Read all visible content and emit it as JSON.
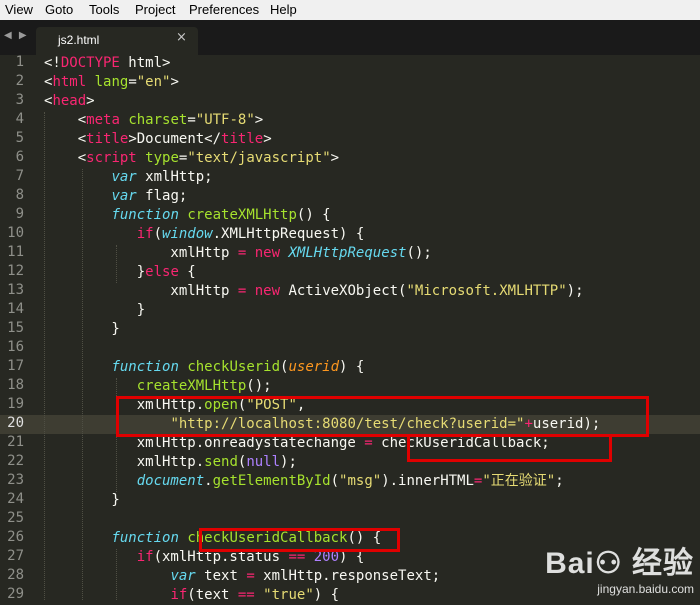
{
  "menu": [
    "View",
    "Goto",
    "Tools",
    "Project",
    "Preferences",
    "Help"
  ],
  "tab": {
    "nav_icons": "◀ ▶",
    "title": "js2.html",
    "close": "×"
  },
  "editor": {
    "active_line": 20,
    "lines": [
      {
        "n": "1",
        "tokens": [
          [
            "w",
            "<!"
          ],
          [
            "k",
            "DOCTYPE"
          ],
          [
            "w",
            " html>"
          ]
        ]
      },
      {
        "n": "2",
        "tokens": [
          [
            "w",
            "<"
          ],
          [
            "k",
            "html"
          ],
          [
            "w",
            " "
          ],
          [
            "a",
            "lang"
          ],
          [
            "w",
            "="
          ],
          [
            "s",
            "\"en\""
          ],
          [
            "w",
            ">"
          ]
        ]
      },
      {
        "n": "3",
        "tokens": [
          [
            "w",
            "<"
          ],
          [
            "k",
            "head"
          ],
          [
            "w",
            ">"
          ]
        ]
      },
      {
        "n": "4",
        "tokens": [
          [
            "w",
            "    <"
          ],
          [
            "k",
            "meta"
          ],
          [
            "w",
            " "
          ],
          [
            "a",
            "charset"
          ],
          [
            "w",
            "="
          ],
          [
            "s",
            "\"UTF-8\""
          ],
          [
            "w",
            ">"
          ]
        ]
      },
      {
        "n": "5",
        "tokens": [
          [
            "w",
            "    <"
          ],
          [
            "k",
            "title"
          ],
          [
            "w",
            ">Document</"
          ],
          [
            "k",
            "title"
          ],
          [
            "w",
            ">"
          ]
        ]
      },
      {
        "n": "6",
        "tokens": [
          [
            "w",
            "    <"
          ],
          [
            "k",
            "script"
          ],
          [
            "w",
            " "
          ],
          [
            "a",
            "type"
          ],
          [
            "w",
            "="
          ],
          [
            "s",
            "\"text/javascript\""
          ],
          [
            "w",
            ">"
          ]
        ]
      },
      {
        "n": "7",
        "tokens": [
          [
            "w",
            "        "
          ],
          [
            "t",
            "var"
          ],
          [
            "w",
            " xmlHttp;"
          ]
        ]
      },
      {
        "n": "8",
        "tokens": [
          [
            "w",
            "        "
          ],
          [
            "t",
            "var"
          ],
          [
            "w",
            " flag;"
          ]
        ]
      },
      {
        "n": "9",
        "tokens": [
          [
            "w",
            "        "
          ],
          [
            "t",
            "function"
          ],
          [
            "w",
            " "
          ],
          [
            "a",
            "createXMLHttp"
          ],
          [
            "w",
            "() {"
          ]
        ]
      },
      {
        "n": "10",
        "tokens": [
          [
            "w",
            "           "
          ],
          [
            "k",
            "if"
          ],
          [
            "w",
            "("
          ],
          [
            "t",
            "window"
          ],
          [
            "w",
            ".XMLHttpRequest) {"
          ]
        ]
      },
      {
        "n": "11",
        "tokens": [
          [
            "w",
            "               xmlHttp "
          ],
          [
            "k",
            "="
          ],
          [
            "w",
            " "
          ],
          [
            "k",
            "new"
          ],
          [
            "w",
            " "
          ],
          [
            "t",
            "XMLHttpRequest"
          ],
          [
            "w",
            "();"
          ]
        ]
      },
      {
        "n": "12",
        "tokens": [
          [
            "w",
            "           }"
          ],
          [
            "k",
            "else"
          ],
          [
            "w",
            " {"
          ]
        ]
      },
      {
        "n": "13",
        "tokens": [
          [
            "w",
            "               xmlHttp "
          ],
          [
            "k",
            "="
          ],
          [
            "w",
            " "
          ],
          [
            "k",
            "new"
          ],
          [
            "w",
            " ActiveXObject("
          ],
          [
            "s",
            "\"Microsoft.XMLHTTP\""
          ],
          [
            "w",
            ");"
          ]
        ]
      },
      {
        "n": "14",
        "tokens": [
          [
            "w",
            "           }"
          ]
        ]
      },
      {
        "n": "15",
        "tokens": [
          [
            "w",
            "        }"
          ]
        ]
      },
      {
        "n": "16",
        "tokens": []
      },
      {
        "n": "17",
        "tokens": [
          [
            "w",
            "        "
          ],
          [
            "t",
            "function"
          ],
          [
            "w",
            " "
          ],
          [
            "a",
            "checkUserid"
          ],
          [
            "w",
            "("
          ],
          [
            "p",
            "userid"
          ],
          [
            "w",
            ") {"
          ]
        ]
      },
      {
        "n": "18",
        "tokens": [
          [
            "w",
            "           "
          ],
          [
            "a",
            "createXMLHttp"
          ],
          [
            "w",
            "();"
          ]
        ]
      },
      {
        "n": "19",
        "tokens": [
          [
            "w",
            "           xmlHttp."
          ],
          [
            "a",
            "open"
          ],
          [
            "w",
            "("
          ],
          [
            "s",
            "\"POST\""
          ],
          [
            "w",
            ","
          ]
        ]
      },
      {
        "n": "20",
        "tokens": [
          [
            "w",
            "               "
          ],
          [
            "s",
            "\"http://localhost:8080/test/check?userid=\""
          ],
          [
            "k",
            "+"
          ],
          [
            "w",
            "userid);"
          ]
        ]
      },
      {
        "n": "21",
        "tokens": [
          [
            "w",
            "           xmlHttp.onreadystatechange "
          ],
          [
            "k",
            "="
          ],
          [
            "w",
            " checkUseridCallback;"
          ]
        ]
      },
      {
        "n": "22",
        "tokens": [
          [
            "w",
            "           xmlHttp."
          ],
          [
            "a",
            "send"
          ],
          [
            "w",
            "("
          ],
          [
            "n",
            "null"
          ],
          [
            "w",
            ");"
          ]
        ]
      },
      {
        "n": "23",
        "tokens": [
          [
            "w",
            "           "
          ],
          [
            "t",
            "document"
          ],
          [
            "w",
            "."
          ],
          [
            "a",
            "getElementById"
          ],
          [
            "w",
            "("
          ],
          [
            "s",
            "\"msg\""
          ],
          [
            "w",
            ").innerHTML"
          ],
          [
            "k",
            "="
          ],
          [
            "s",
            "\"正在验证\""
          ],
          [
            "w",
            ";"
          ]
        ]
      },
      {
        "n": "24",
        "tokens": [
          [
            "w",
            "        }"
          ]
        ]
      },
      {
        "n": "25",
        "tokens": []
      },
      {
        "n": "26",
        "tokens": [
          [
            "w",
            "        "
          ],
          [
            "t",
            "function"
          ],
          [
            "w",
            " "
          ],
          [
            "a",
            "checkUseridCallback"
          ],
          [
            "w",
            "() {"
          ]
        ]
      },
      {
        "n": "27",
        "tokens": [
          [
            "w",
            "           "
          ],
          [
            "k",
            "if"
          ],
          [
            "w",
            "(xmlHttp.status "
          ],
          [
            "k",
            "=="
          ],
          [
            "w",
            " "
          ],
          [
            "n",
            "200"
          ],
          [
            "w",
            ") {"
          ]
        ]
      },
      {
        "n": "28",
        "tokens": [
          [
            "w",
            "               "
          ],
          [
            "t",
            "var"
          ],
          [
            "w",
            " text "
          ],
          [
            "k",
            "="
          ],
          [
            "w",
            " xmlHttp.responseText;"
          ]
        ]
      },
      {
        "n": "29",
        "tokens": [
          [
            "w",
            "               "
          ],
          [
            "k",
            "if"
          ],
          [
            "w",
            "(text "
          ],
          [
            "k",
            "=="
          ],
          [
            "w",
            " "
          ],
          [
            "s",
            "\"true\""
          ],
          [
            "w",
            ") {"
          ]
        ]
      }
    ]
  },
  "watermark": {
    "logo": "Bai⚇ 经验",
    "url": "jingyan.baidu.com"
  },
  "colors": {
    "background": "#272822",
    "annotation": "#e00000"
  }
}
